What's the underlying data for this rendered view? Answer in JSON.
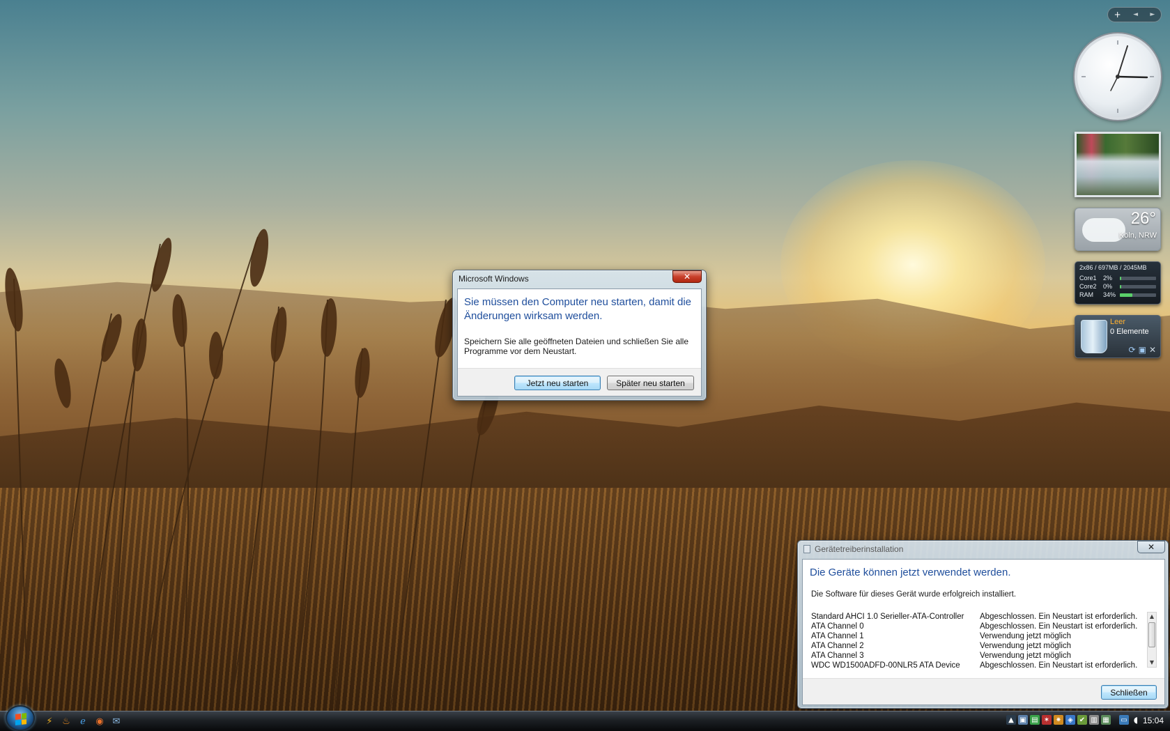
{
  "gadget_toolbar": {
    "add": "+",
    "prev": "◄",
    "next": "►"
  },
  "weather": {
    "temperature": "26°",
    "city": "Köln, NRW"
  },
  "cpu_meter": {
    "header": "2x86 / 697MB / 2045MB",
    "rows": [
      {
        "name": "Core1",
        "value": "2%",
        "level": 0.02
      },
      {
        "name": "Core2",
        "value": "0%",
        "level": 0.0
      },
      {
        "name": "RAM",
        "value": "34%",
        "level": 0.34
      }
    ]
  },
  "recycle_bin": {
    "status": "Leer",
    "count": "0 Elemente"
  },
  "restart_dialog": {
    "title": "Microsoft Windows",
    "heading": "Sie müssen den Computer neu starten, damit die Änderungen wirksam werden.",
    "message": "Speichern Sie alle geöffneten Dateien und schließen Sie alle Programme vor dem Neustart.",
    "restart_now": "Jetzt neu starten",
    "restart_later": "Später neu starten",
    "close": "✕"
  },
  "driver_dialog": {
    "title": "Gerätetreiberinstallation",
    "heading": "Die Geräte können jetzt verwendet werden.",
    "message": "Die Software für dieses Gerät wurde erfolgreich installiert.",
    "close_label": "Schließen",
    "close_x": "✕",
    "devices": [
      {
        "name": "Standard AHCI 1.0 Serieller-ATA-Controller",
        "status": "Abgeschlossen. Ein Neustart ist erforderlich."
      },
      {
        "name": "ATA Channel 0",
        "status": "Abgeschlossen. Ein Neustart ist erforderlich."
      },
      {
        "name": "ATA Channel 1",
        "status": "Verwendung jetzt möglich"
      },
      {
        "name": "ATA Channel 2",
        "status": "Verwendung jetzt möglich"
      },
      {
        "name": "ATA Channel 3",
        "status": "Verwendung jetzt möglich"
      },
      {
        "name": "WDC WD1500ADFD-00NLR5 ATA Device",
        "status": "Abgeschlossen. Ein Neustart ist erforderlich."
      }
    ]
  },
  "taskbar": {
    "clock": "15:04"
  },
  "colors": {
    "heading_blue": "#1f4e9c",
    "ram_bar_green": "#5ad06a",
    "bin_status_orange": "#ffb030"
  }
}
